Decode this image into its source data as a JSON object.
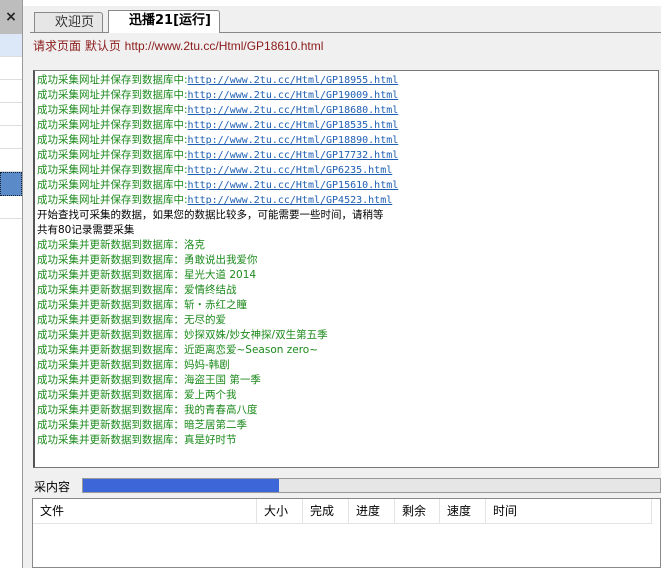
{
  "left_panel": {
    "close": "×"
  },
  "tabs": [
    {
      "label": "欢迎页",
      "active": false
    },
    {
      "label": "迅播21[运行]",
      "active": true
    }
  ],
  "request": {
    "label": "请求页面 默认页",
    "url": "http://www.2tu.cc/Html/GP18610.html"
  },
  "log": {
    "url_prefix": "成功采集网址并保存到数据库中:",
    "urls": [
      "http://www.2tu.cc/Html/GP18955.html",
      "http://www.2tu.cc/Html/GP19009.html",
      "http://www.2tu.cc/Html/GP18680.html",
      "http://www.2tu.cc/Html/GP18535.html",
      "http://www.2tu.cc/Html/GP18890.html",
      "http://www.2tu.cc/Html/GP17732.html",
      "http://www.2tu.cc/Html/GP6235.html",
      "http://www.2tu.cc/Html/GP15610.html",
      "http://www.2tu.cc/Html/GP4523.html"
    ],
    "msg1": "开始查找可采集的数据，如果您的数据比较多，可能需要一些时间，请稍等",
    "msg2": "共有80记录需要采集",
    "update_prefix": "成功采集并更新数据到数据库：",
    "titles": [
      "洛克",
      "勇敢说出我爱你",
      "星光大道 2014",
      "爱情终结战",
      "斩・赤红之瞳",
      "无尽的爱",
      "妙探双姝/妙女神探/双生第五季",
      "近距离恋爱~Season zero~",
      "妈妈-韩剧",
      "海盗王国 第一季",
      "爱上两个我",
      "我的青春高八度",
      "暗芝居第二季",
      "真是好时节"
    ]
  },
  "progress": {
    "label": "采内容",
    "percent": 34,
    "color": "#3d67d8"
  },
  "table": {
    "columns": [
      "文件",
      "大小",
      "完成",
      "进度",
      "剩余",
      "速度",
      "时间"
    ]
  }
}
